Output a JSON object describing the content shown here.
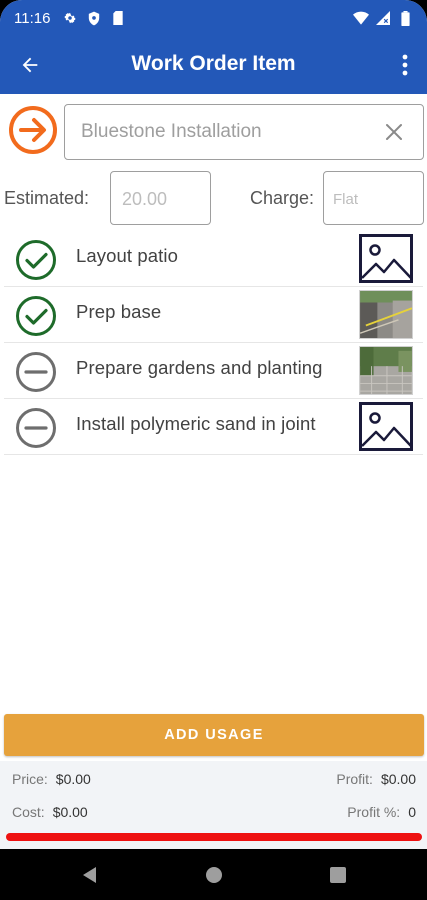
{
  "status_bar": {
    "time": "11:16",
    "left_icons": [
      "gear-icon",
      "shield-icon",
      "sim-card-icon"
    ],
    "right_icons": [
      "wifi-icon",
      "signal-icon",
      "battery-icon"
    ]
  },
  "app_bar": {
    "title": "Work Order Item",
    "back_icon": "arrow-left-icon",
    "menu_icon": "more-vert-icon"
  },
  "item": {
    "name": "Bluestone Installation",
    "go_icon": "arrow-circle-right-icon",
    "clear_icon": "close-icon"
  },
  "fields": {
    "estimated_label": "Estimated:",
    "estimated_value": "20.00",
    "charge_label": "Charge:",
    "charge_value": "Flat"
  },
  "tasks": [
    {
      "label": "Layout patio",
      "status": "complete",
      "thumbnail": "image-placeholder-icon"
    },
    {
      "label": "Prep base",
      "status": "complete",
      "thumbnail": "photo"
    },
    {
      "label": "Prepare gardens and planting",
      "status": "incomplete",
      "thumbnail": "photo"
    },
    {
      "label": "Install polymeric sand in joint",
      "status": "incomplete",
      "thumbnail": "image-placeholder-icon"
    }
  ],
  "add_usage_label": "ADD USAGE",
  "summary": {
    "price_label": "Price:",
    "price_value": "$0.00",
    "profit_label": "Profit:",
    "profit_value": "$0.00",
    "cost_label": "Cost:",
    "cost_value": "$0.00",
    "profit_pct_label": "Profit %:",
    "profit_pct_value": "0"
  },
  "colors": {
    "primary": "#2358b8",
    "accent_orange": "#f26b1d",
    "check_green": "#1e6b2a",
    "add_usage": "#e6a23c",
    "progress_red": "#ee1111"
  },
  "nav": [
    "back-triangle-icon",
    "home-circle-icon",
    "recents-square-icon"
  ]
}
